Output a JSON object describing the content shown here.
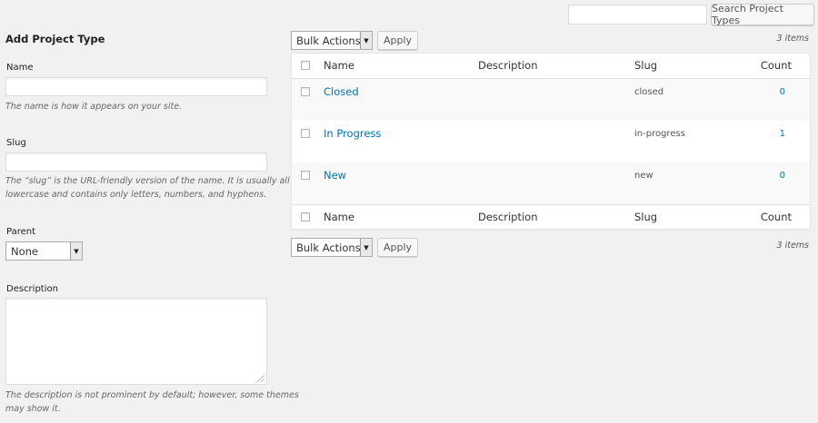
{
  "search": {
    "value": "",
    "button_label": "Search Project Types"
  },
  "form": {
    "title": "Add Project Type",
    "name_label": "Name",
    "name_value": "",
    "name_help": "The name is how it appears on your site.",
    "slug_label": "Slug",
    "slug_value": "",
    "slug_help_line1": "The “slug” is the URL-friendly version of the name. It is usually all",
    "slug_help_line2": "lowercase and contains only letters, numbers, and hyphens.",
    "parent_label": "Parent",
    "parent_selected": "None",
    "description_label": "Description",
    "description_value": "",
    "description_help_line1": "The description is not prominent by default; however, some themes",
    "description_help_line2": "may show it."
  },
  "bulk": {
    "top_action": "Bulk Actions",
    "top_apply": "Apply",
    "bottom_action": "Bulk Actions",
    "bottom_apply": "Apply",
    "items_count": "3 items"
  },
  "table": {
    "columns": {
      "name": "Name",
      "description": "Description",
      "slug": "Slug",
      "count": "Count"
    },
    "rows": [
      {
        "name": "Closed",
        "description": "",
        "slug": "closed",
        "count": "0"
      },
      {
        "name": "In Progress",
        "description": "",
        "slug": "in-progress",
        "count": "1"
      },
      {
        "name": "New",
        "description": "",
        "slug": "new",
        "count": "0"
      }
    ]
  },
  "colors": {
    "link": "#0073aa",
    "background": "#f1f1f1"
  },
  "icons": {
    "select_arrow": "triangle-down-icon",
    "textarea_resize": "resize-grip-icon"
  }
}
